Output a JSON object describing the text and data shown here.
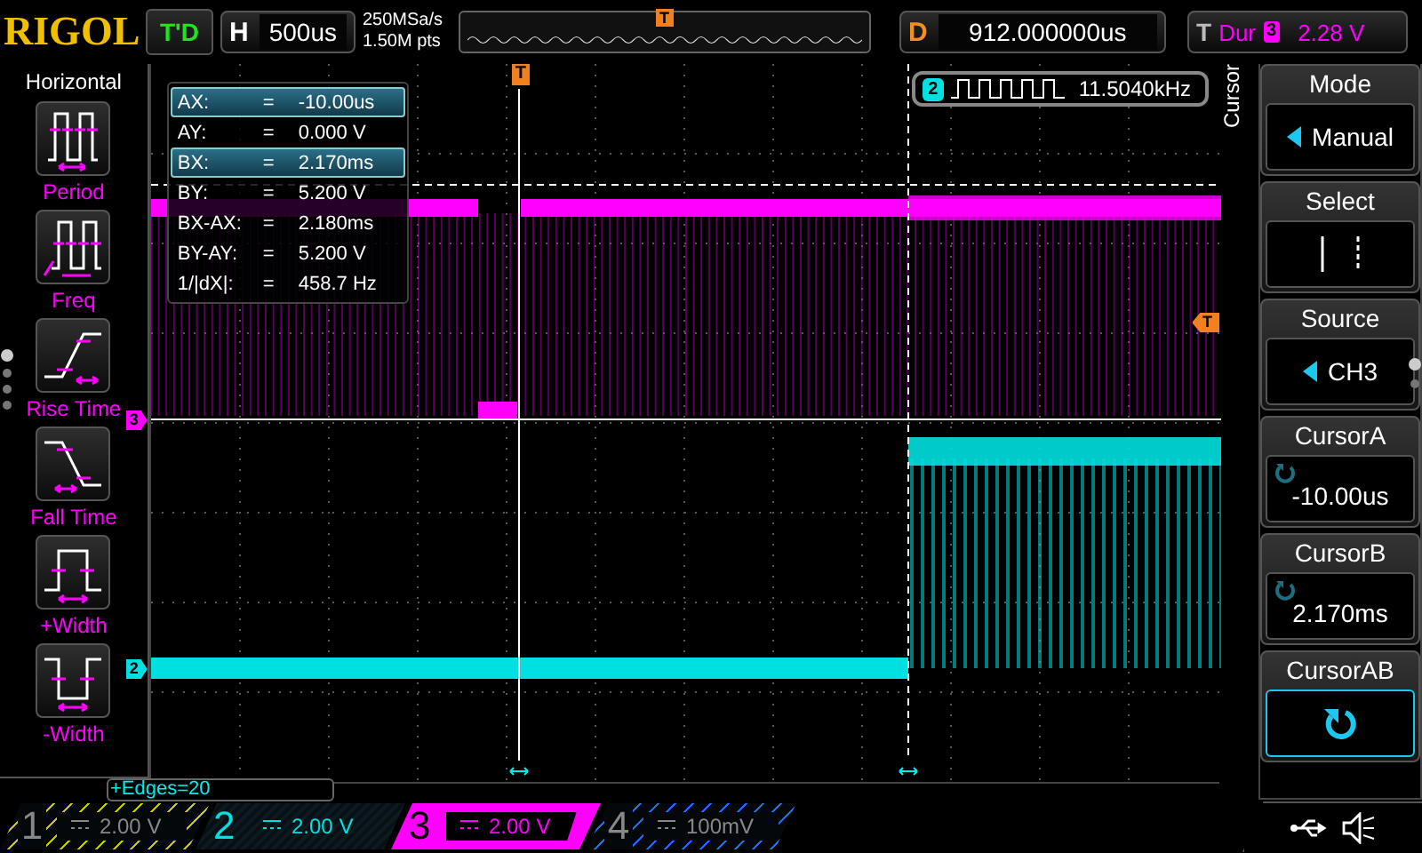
{
  "top_bar": {
    "logo": "RIGOL",
    "run_state": "T'D",
    "timebase_label": "H",
    "timebase": "500us",
    "sample_rate": "250MSa/s",
    "memory_depth": "1.50M pts",
    "trigger_position_marker": "T",
    "delay_label": "D",
    "delay": "912.000000us",
    "trigger_label": "T",
    "trigger_type": "Dur",
    "trigger_source": "3",
    "trigger_level": "2.28 V"
  },
  "left_menu": {
    "title": "Horizontal",
    "items": [
      {
        "label": "Period",
        "kind": "period"
      },
      {
        "label": "Freq",
        "kind": "freq"
      },
      {
        "label": "Rise Time",
        "kind": "rise"
      },
      {
        "label": "Fall Time",
        "kind": "fall"
      },
      {
        "label": "+Width",
        "kind": "pwidth"
      },
      {
        "label": "-Width",
        "kind": "nwidth"
      }
    ]
  },
  "cursor_readout": [
    {
      "label": "AX:",
      "sign": "=",
      "value": "-10.00us",
      "selected": true
    },
    {
      "label": "AY:",
      "sign": "=",
      "value": "0.000 V",
      "selected": false
    },
    {
      "label": "BX:",
      "sign": "=",
      "value": "2.170ms",
      "selected": true
    },
    {
      "label": "BY:",
      "sign": "=",
      "value": "5.200 V",
      "selected": false
    },
    {
      "label": "BX-AX:",
      "sign": "=",
      "value": "2.180ms",
      "selected": false
    },
    {
      "label": "BY-AY:",
      "sign": "=",
      "value": "5.200 V",
      "selected": false
    },
    {
      "label": "1/|dX|:",
      "sign": "=",
      "value": "458.7 Hz",
      "selected": false
    }
  ],
  "frequency_counter": {
    "channel": "2",
    "value": "11.5040kHz"
  },
  "plot": {
    "trigger_marker": "T",
    "trigger_level_marker": "T",
    "channel_markers": [
      "3",
      "2"
    ]
  },
  "measurement_status": "+Edges=20",
  "right_menu": {
    "title": "Cursor",
    "items": [
      {
        "label": "Mode",
        "kind": "option",
        "value": "Manual"
      },
      {
        "label": "Select",
        "kind": "select"
      },
      {
        "label": "Source",
        "kind": "option",
        "value": "CH3"
      },
      {
        "label": "CursorA",
        "kind": "knob",
        "value": "-10.00us"
      },
      {
        "label": "CursorB",
        "kind": "knob",
        "value": "2.170ms"
      },
      {
        "label": "CursorAB",
        "kind": "knob_button"
      }
    ]
  },
  "channels": [
    {
      "number": "1",
      "scale": "2.00 V",
      "on": false,
      "selected": false,
      "color": "#c8c800"
    },
    {
      "number": "2",
      "scale": "2.00 V",
      "on": true,
      "selected": false,
      "color": "#00e0e0"
    },
    {
      "number": "3",
      "scale": "2.00 V",
      "on": true,
      "selected": true,
      "color": "#ff00ff"
    },
    {
      "number": "4",
      "scale": "100mV",
      "on": false,
      "selected": false,
      "color": "#1a6cff"
    }
  ]
}
